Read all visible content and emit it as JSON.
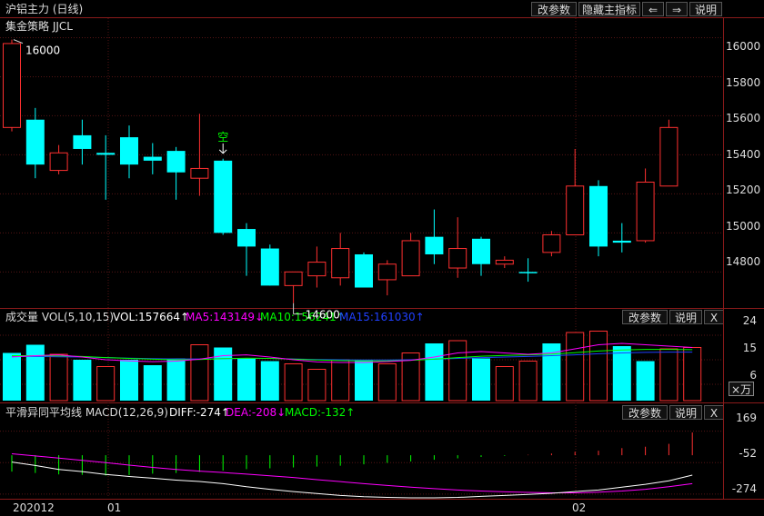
{
  "window": {
    "title": "沪铝主力 (日线)",
    "buttons": {
      "params": "改参数",
      "hide": "隐藏主指标",
      "left": "⇐",
      "right": "⇒",
      "help": "说明"
    }
  },
  "main": {
    "indicator_name": "集金策略 JJCL",
    "high_label": "16000",
    "low_label": "14600",
    "signal_label": "空",
    "yticks": [
      "16000",
      "15800",
      "15600",
      "15400",
      "15200",
      "15000",
      "14800"
    ]
  },
  "volume": {
    "title": "成交量 VOL(5,10,15)",
    "vol": "VOL:157664↑",
    "ma5": "MA5:143149↓",
    "ma10": "MA10:156241↑",
    "ma15": "MA15:161030↑",
    "buttons": {
      "params": "改参数",
      "help": "说明",
      "close": "X"
    },
    "yticks": [
      "24",
      "15",
      "6"
    ],
    "unit": "×万"
  },
  "macd": {
    "title": "平滑异同平均线 MACD(12,26,9)",
    "diff": "DIFF:-274↑",
    "dea": "DEA:-208↓",
    "macd": "MACD:-132↑",
    "buttons": {
      "params": "改参数",
      "help": "说明",
      "close": "X"
    },
    "yticks": [
      "169",
      "-52",
      "-274"
    ]
  },
  "xaxis": {
    "labels": [
      "202012",
      "01",
      "02"
    ]
  },
  "colors": {
    "up": "#ff3030",
    "down": "#00ffff",
    "flat": "#00ffff",
    "ma5": "#ff00ff",
    "ma10": "#00ff00",
    "ma15": "#2040ff",
    "dea": "#ff00ff",
    "diff": "#ffffff",
    "grid": "#551414",
    "panel_border": "#8a1a1a"
  },
  "chart_data": [
    {
      "type": "candlestick",
      "title": "沪铝主力 (日线)",
      "ylim": [
        14620,
        16100
      ],
      "candles": [
        {
          "o": 15540,
          "h": 15990,
          "l": 15520,
          "c": 15970
        },
        {
          "o": 15580,
          "h": 15640,
          "l": 15280,
          "c": 15350
        },
        {
          "o": 15320,
          "h": 15450,
          "l": 15300,
          "c": 15410
        },
        {
          "o": 15500,
          "h": 15580,
          "l": 15350,
          "c": 15430
        },
        {
          "o": 15410,
          "h": 15500,
          "l": 15170,
          "c": 15400
        },
        {
          "o": 15490,
          "h": 15550,
          "l": 15280,
          "c": 15350
        },
        {
          "o": 15390,
          "h": 15460,
          "l": 15300,
          "c": 15370
        },
        {
          "o": 15420,
          "h": 15440,
          "l": 15170,
          "c": 15310
        },
        {
          "o": 15280,
          "h": 15610,
          "l": 15190,
          "c": 15330
        },
        {
          "o": 15370,
          "h": 15380,
          "l": 14990,
          "c": 15000
        },
        {
          "o": 15020,
          "h": 15050,
          "l": 14780,
          "c": 14930
        },
        {
          "o": 14920,
          "h": 14940,
          "l": 14730,
          "c": 14730
        },
        {
          "o": 14730,
          "h": 14800,
          "l": 14640,
          "c": 14800
        },
        {
          "o": 14780,
          "h": 14930,
          "l": 14720,
          "c": 14850
        },
        {
          "o": 14770,
          "h": 15000,
          "l": 14730,
          "c": 14920
        },
        {
          "o": 14890,
          "h": 14900,
          "l": 14720,
          "c": 14720
        },
        {
          "o": 14760,
          "h": 14860,
          "l": 14680,
          "c": 14840
        },
        {
          "o": 14780,
          "h": 15000,
          "l": 14780,
          "c": 14960
        },
        {
          "o": 14980,
          "h": 15120,
          "l": 14840,
          "c": 14890
        },
        {
          "o": 14820,
          "h": 15080,
          "l": 14770,
          "c": 14920
        },
        {
          "o": 14970,
          "h": 14980,
          "l": 14780,
          "c": 14840
        },
        {
          "o": 14840,
          "h": 14880,
          "l": 14820,
          "c": 14860
        },
        {
          "o": 14800,
          "h": 14870,
          "l": 14750,
          "c": 14800
        },
        {
          "o": 14900,
          "h": 15010,
          "l": 14880,
          "c": 14990
        },
        {
          "o": 14990,
          "h": 15430,
          "l": 14990,
          "c": 15240
        },
        {
          "o": 15240,
          "h": 15270,
          "l": 14880,
          "c": 14930
        },
        {
          "o": 14960,
          "h": 15050,
          "l": 14900,
          "c": 14950
        },
        {
          "o": 14960,
          "h": 15330,
          "l": 14950,
          "c": 15260
        },
        {
          "o": 15240,
          "h": 15580,
          "l": 15240,
          "c": 15540
        }
      ]
    },
    {
      "type": "bar",
      "title": "成交量 VOL(5,10,15)",
      "unit": "×万",
      "ylim": [
        0,
        28
      ],
      "values": [
        17.5,
        20.5,
        17,
        15,
        12.5,
        15,
        13,
        15.5,
        20.5,
        19.5,
        15.5,
        14.5,
        13.5,
        11.5,
        15,
        15,
        13.5,
        17.5,
        21,
        22,
        15.5,
        12.5,
        14.5,
        21,
        25,
        25.5,
        20,
        14.5,
        19,
        19.5
      ],
      "up_flags": [
        false,
        false,
        true,
        false,
        true,
        false,
        false,
        false,
        true,
        false,
        false,
        false,
        true,
        true,
        true,
        false,
        true,
        true,
        false,
        true,
        false,
        true,
        true,
        false,
        true,
        true,
        false,
        false,
        true,
        true
      ],
      "ma5": [
        16,
        16.5,
        16.8,
        16,
        15,
        14.6,
        14.3,
        14.5,
        15.2,
        16.5,
        16.8,
        16,
        15,
        14.2,
        14,
        14,
        14.3,
        14.8,
        16,
        17.5,
        18,
        17.5,
        17,
        17.5,
        19,
        20.5,
        21,
        20.5,
        20,
        19.5
      ],
      "ma10": [
        16.5,
        16.5,
        16.4,
        16.2,
        15.8,
        15.5,
        15.2,
        15,
        15.1,
        15.4,
        15.6,
        15.5,
        15.2,
        14.9,
        14.7,
        14.6,
        14.6,
        14.8,
        15.2,
        15.8,
        16.3,
        16.6,
        16.8,
        17.1,
        17.6,
        18.2,
        18.6,
        18.8,
        18.8,
        18.7
      ],
      "ma15": [
        16.2,
        16.2,
        16.1,
        16,
        15.8,
        15.6,
        15.4,
        15.3,
        15.3,
        15.4,
        15.5,
        15.5,
        15.3,
        15.1,
        15,
        14.9,
        14.9,
        15,
        15.2,
        15.5,
        15.8,
        16,
        16.2,
        16.5,
        16.8,
        17.2,
        17.5,
        17.7,
        17.8,
        17.8
      ]
    },
    {
      "type": "line",
      "title": "平滑异同平均线 MACD(12,26,9)",
      "ylim": [
        -300,
        250
      ],
      "diff": [
        -48,
        -72,
        -100,
        -115,
        -135,
        -150,
        -162,
        -175,
        -185,
        -200,
        -222,
        -240,
        -256,
        -270,
        -283,
        -292,
        -297,
        -300,
        -300,
        -297,
        -290,
        -283,
        -276,
        -268,
        -256,
        -245,
        -225,
        -205,
        -180,
        -140
      ],
      "dea": [
        10,
        -5,
        -20,
        -36,
        -52,
        -70,
        -86,
        -100,
        -112,
        -122,
        -133,
        -145,
        -157,
        -172,
        -186,
        -200,
        -213,
        -225,
        -235,
        -245,
        -252,
        -258,
        -262,
        -265,
        -265,
        -260,
        -252,
        -240,
        -222,
        -200
      ],
      "macd": [
        -115,
        -125,
        -135,
        -138,
        -143,
        -140,
        -130,
        -125,
        -118,
        -108,
        -98,
        -92,
        -86,
        -80,
        -74,
        -64,
        -54,
        -44,
        -32,
        -22,
        -12,
        -5,
        3,
        12,
        24,
        32,
        50,
        60,
        80,
        160
      ]
    }
  ]
}
